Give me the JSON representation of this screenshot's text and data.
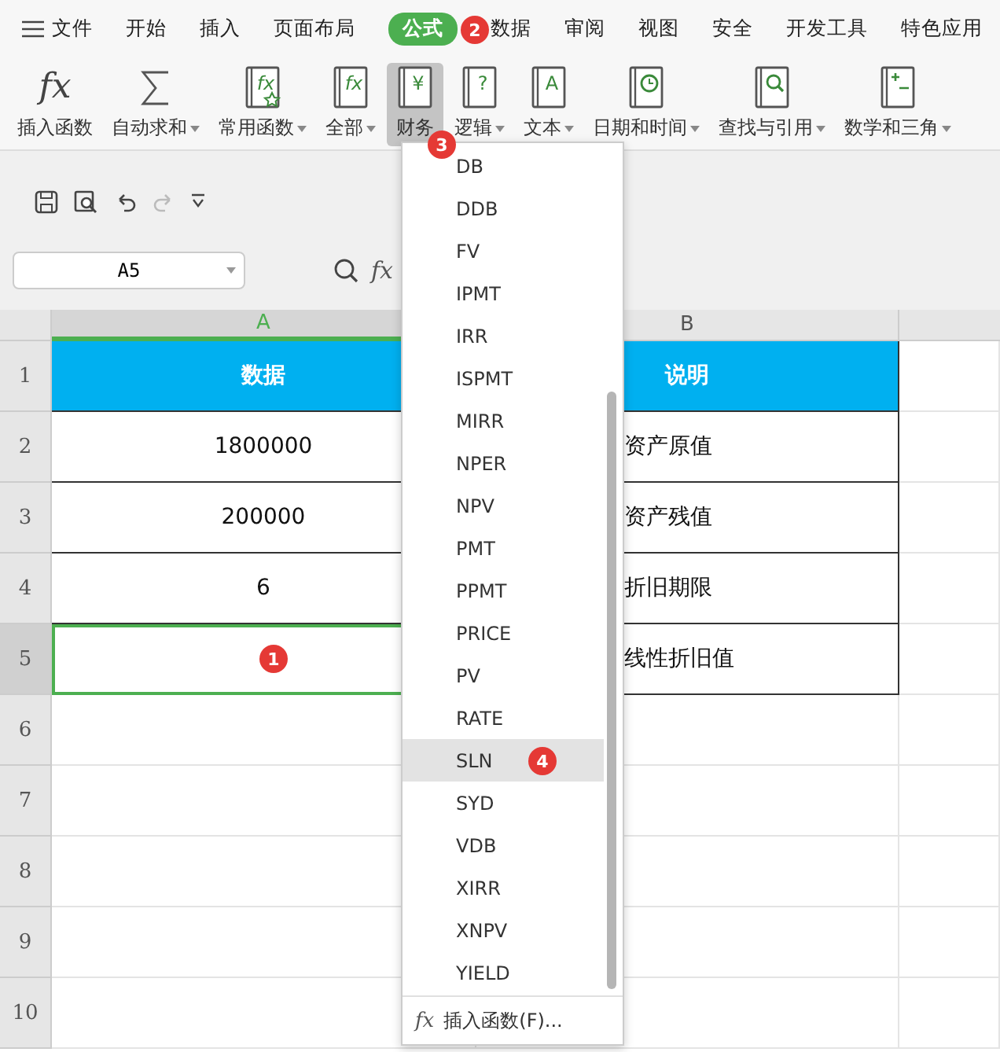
{
  "menu_tabs": [
    {
      "label": "文件",
      "kind": "file",
      "selected": false
    },
    {
      "label": "开始",
      "selected": false
    },
    {
      "label": "插入",
      "selected": false
    },
    {
      "label": "页面布局",
      "selected": false
    },
    {
      "label": "公式",
      "selected": true,
      "badge": "2"
    },
    {
      "label": "数据",
      "selected": false
    },
    {
      "label": "审阅",
      "selected": false
    },
    {
      "label": "视图",
      "selected": false
    },
    {
      "label": "安全",
      "selected": false
    },
    {
      "label": "开发工具",
      "selected": false
    },
    {
      "label": "特色应用",
      "selected": false
    }
  ],
  "ribbon": [
    {
      "label": "插入函数",
      "glyph": "fx",
      "caret": false,
      "selected": false
    },
    {
      "label": "自动求和",
      "caret": true,
      "selected": false
    },
    {
      "label": "常用函数",
      "glyph": "fx",
      "caret": true,
      "selected": false
    },
    {
      "label": "全部",
      "glyph": "fx",
      "caret": true,
      "selected": false
    },
    {
      "label": "财务",
      "glyph": "¥",
      "caret": false,
      "selected": true,
      "badge": "3"
    },
    {
      "label": "逻辑",
      "glyph": "?",
      "caret": true,
      "selected": false
    },
    {
      "label": "文本",
      "glyph": "A",
      "caret": true,
      "selected": false
    },
    {
      "label": "日期和时间",
      "caret": true,
      "selected": false
    },
    {
      "label": "查找与引用",
      "caret": true,
      "selected": false
    },
    {
      "label": "数学和三角",
      "caret": true,
      "selected": false
    }
  ],
  "name_box": "A5",
  "formula_label": "fx",
  "columns": [
    {
      "label": "A",
      "selected": true
    },
    {
      "label": "B",
      "selected": false
    }
  ],
  "rows": [
    {
      "number": "1",
      "kind": "header",
      "selected": false,
      "cells": [
        "数据",
        "说明"
      ]
    },
    {
      "number": "2",
      "kind": "data",
      "selected": false,
      "cells": [
        "1800000",
        "资产原值"
      ]
    },
    {
      "number": "3",
      "kind": "data",
      "selected": false,
      "cells": [
        "200000",
        "资产残值"
      ]
    },
    {
      "number": "4",
      "kind": "data",
      "selected": false,
      "cells": [
        "6",
        "折旧期限"
      ]
    },
    {
      "number": "5",
      "kind": "data",
      "selected": true,
      "cells": [
        "",
        "线性折旧值"
      ],
      "badge": "1"
    },
    {
      "number": "6",
      "kind": "empty",
      "selected": false,
      "cells": []
    },
    {
      "number": "7",
      "kind": "empty",
      "selected": false,
      "cells": []
    },
    {
      "number": "8",
      "kind": "empty",
      "selected": false,
      "cells": []
    },
    {
      "number": "9",
      "kind": "empty",
      "selected": false,
      "cells": []
    },
    {
      "number": "10",
      "kind": "empty",
      "selected": false,
      "cells": []
    }
  ],
  "dropdown": {
    "items": [
      {
        "label": "DB",
        "selected": false
      },
      {
        "label": "DDB",
        "selected": false
      },
      {
        "label": "FV",
        "selected": false
      },
      {
        "label": "IPMT",
        "selected": false
      },
      {
        "label": "IRR",
        "selected": false
      },
      {
        "label": "ISPMT",
        "selected": false
      },
      {
        "label": "MIRR",
        "selected": false
      },
      {
        "label": "NPER",
        "selected": false
      },
      {
        "label": "NPV",
        "selected": false
      },
      {
        "label": "PMT",
        "selected": false
      },
      {
        "label": "PPMT",
        "selected": false
      },
      {
        "label": "PRICE",
        "selected": false
      },
      {
        "label": "PV",
        "selected": false
      },
      {
        "label": "RATE",
        "selected": false
      },
      {
        "label": "SLN",
        "selected": true,
        "badge": "4"
      },
      {
        "label": "SYD",
        "selected": false
      },
      {
        "label": "VDB",
        "selected": false
      },
      {
        "label": "XIRR",
        "selected": false
      },
      {
        "label": "XNPV",
        "selected": false
      },
      {
        "label": "YIELD",
        "selected": false
      }
    ],
    "footer": {
      "glyph": "fx",
      "label": "插入函数(F)..."
    }
  }
}
